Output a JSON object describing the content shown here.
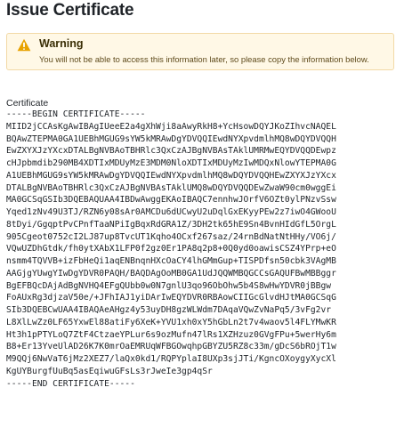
{
  "page": {
    "title": "Issue Certificate"
  },
  "warning": {
    "icon": "warning-triangle-icon",
    "accent_color": "#e8a200",
    "title": "Warning",
    "message": "You will not be able to access this information later, so please copy the information below."
  },
  "certificate": {
    "label": "Certificate",
    "lines": [
      "-----BEGIN CERTIFICATE-----",
      "MIID2jCCAsKgAwIBAgIUeeE2a4gXhWji8aAwyRkH8+YcHsowDQYJKoZIhvcNAQEL",
      "BQAwZTEPMA0GA1UEBhMGUG9sYW5kMRAwDgYDVQQIEwdNYXpvdmlhMQ8wDQYDVQQH",
      "EwZXYXJzYXcxDTALBgNVBAoTBHRlc3QxCzAJBgNVBAsTAklUMRMwEQYDVQQDEwpz",
      "cHJpbmdib290MB4XDTIxMDUyMzE3MDM0NloXDTIxMDUyMzIwMDQxNlowYTEPMA0G",
      "A1UEBhMGUG9sYW5kMRAwDgYDVQQIEwdNYXpvdmlhMQ8wDQYDVQQHEwZXYXJzYXcx",
      "DTALBgNVBAoTBHRlc3QxCzAJBgNVBAsTAklUMQ8wDQYDVQQDEwZwaW90cm0wggEi",
      "MA0GCSqGSIb3DQEBAQUAA4IBDwAwggEKAoIBAQC7ennhwJOrfV6OZt0ylPNzvSsw",
      "Yqed1zNv49U3TJ/RZN6y08sAr0AMCDu6dUCwyU2uDqlGxEKyyPEw2z7iwO4GWooU",
      "8tDyi/GgqptPvCPnfTaaNPiIgBqxRdGRA1Z/3DH2tk65hE9Sn4BvnHIdGfL5OrgL",
      "905Cgeot0752cI2LJ87up8TvcUT1Kqho4OCxf267saz/24rnBdNatNtHHy/VO6j/",
      "VQwUZDhGtdk/fh0ytXAbX1LFP0f2gz0Er1PA8q2p8+0Q0yd0oawisCSZ4YPrp+eO",
      "nsmm4TQVVB+izFbHeQi1aqENBnqnHXcOaCY4lhGMmGup+TISPDfsn50cbk3VAgMB",
      "AAGjgYUwgYIwDgYDVR0PAQH/BAQDAgOoMB0GA1UdJQQWMBQGCCsGAQUFBwMBBggr",
      "BgEFBQcDAjAdBgNVHQ4EFgQUbb0w0N7gnlU3qo96ObOhw5b4S8wHwYDVR0jBBgw",
      "FoAUxRg3djzaV50e/+JFhIAJ1yiDArIwEQYDVR0RBAowCIIGcGlvdHJtMA0GCSqG",
      "SIb3DQEBCwUAA4IBAQAeAHgz4y53uyDH8gzWLWdm7DAqaVQwZvNaPq5/3vFg2vr",
      "L8XlLwZz0LF65YxwEl88atiFy6XeK+YVU1xh0xY5hGbLn2t7v4waov5l4FLYMwKR",
      "Ht3h1pPTYLoQ7ZtF4CtzaeYPLur6s9ozMufn47lRs1XZHzuz0GVgFPu+5werHy6m",
      "B8+Er13YveUlAD26K7K0mrOaEMRUqWFBGOwqhpGBYZU5RZ8c33m/gDcS6bROjT1w",
      "M9QQj6NwVaT6jMz2XEZ7/laQx0kd1/RQPYplaI8UXp3sjJTi/KgncOXoygyXycXl",
      "KgUYBurgfUuBq5asEqiwuGFsLs3rJweIe3gp4qSr",
      "-----END CERTIFICATE-----"
    ]
  }
}
